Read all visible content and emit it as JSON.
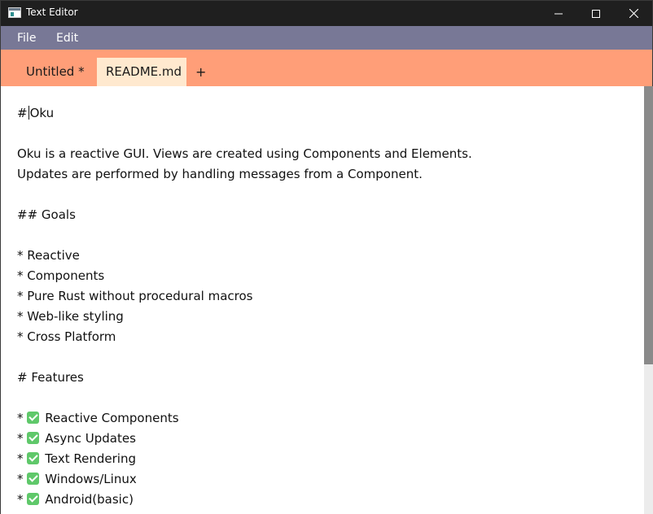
{
  "window": {
    "title": "Text Editor",
    "icon": "app-window-icon"
  },
  "menu": {
    "items": [
      "File",
      "Edit"
    ]
  },
  "tabs": {
    "items": [
      {
        "label": "Untitled *",
        "active": false
      },
      {
        "label": "README.md",
        "active": true
      }
    ],
    "add_label": "+"
  },
  "editor": {
    "cursor_line": 0,
    "lines": [
      {
        "text": "# Oku"
      },
      {
        "text": ""
      },
      {
        "text": "Oku is a reactive GUI. Views are created using Components and Elements."
      },
      {
        "text": "Updates are performed by handling messages from a Component."
      },
      {
        "text": ""
      },
      {
        "text": "## Goals"
      },
      {
        "text": ""
      },
      {
        "text": "* Reactive"
      },
      {
        "text": "* Components"
      },
      {
        "text": "* Pure Rust without procedural macros"
      },
      {
        "text": "* Web-like styling"
      },
      {
        "text": "* Cross Platform"
      },
      {
        "text": ""
      },
      {
        "text": "# Features"
      },
      {
        "text": ""
      },
      {
        "text": "Reactive Components",
        "prefix": "* ",
        "check": true
      },
      {
        "text": "Async Updates",
        "prefix": "* ",
        "check": true
      },
      {
        "text": "Text Rendering",
        "prefix": "* ",
        "check": true
      },
      {
        "text": "Windows/Linux",
        "prefix": "* ",
        "check": true
      },
      {
        "text": "Android(basic)",
        "prefix": "* ",
        "check": true
      }
    ]
  },
  "colors": {
    "titlebar": "#1f1f1f",
    "menubar": "#787896",
    "tabbar": "#ff9e78",
    "active_tab": "#ffe9cf",
    "check": "#5fc86a"
  }
}
